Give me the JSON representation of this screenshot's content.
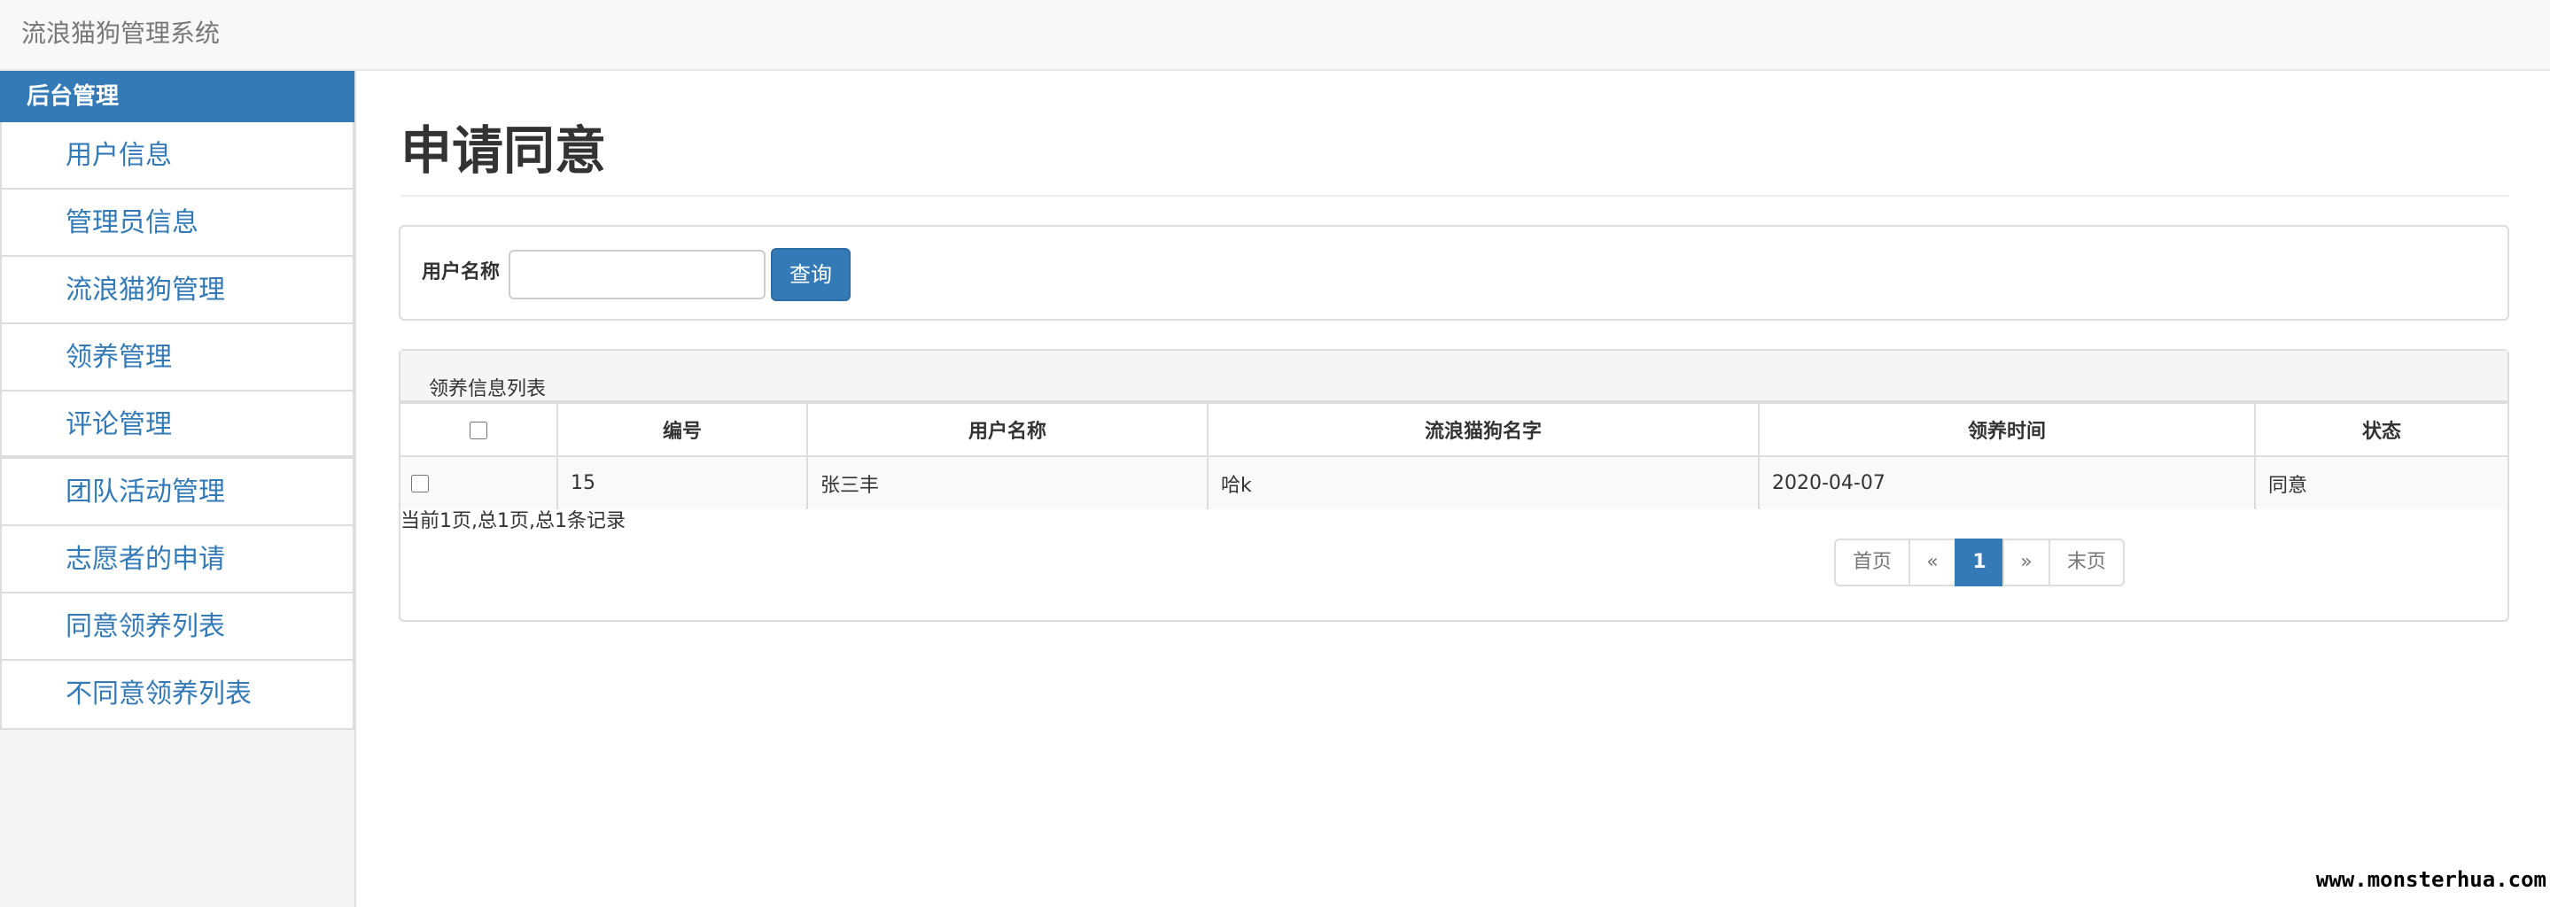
{
  "app": {
    "title": "流浪猫狗管理系统"
  },
  "sidebar": {
    "heading": "后台管理",
    "items": [
      {
        "label": "用户信息"
      },
      {
        "label": "管理员信息"
      },
      {
        "label": "流浪猫狗管理"
      },
      {
        "label": "领养管理"
      },
      {
        "label": "评论管理"
      },
      {
        "label": "团队活动管理"
      },
      {
        "label": "志愿者的申请"
      },
      {
        "label": "同意领养列表"
      },
      {
        "label": "不同意领养列表"
      }
    ]
  },
  "page": {
    "title": "申请同意"
  },
  "search": {
    "label": "用户名称",
    "value": "",
    "button_label": "查询"
  },
  "list": {
    "heading": "领养信息列表",
    "columns": [
      "编号",
      "用户名称",
      "流浪猫狗名字",
      "领养时间",
      "状态"
    ],
    "rows": [
      {
        "id": "15",
        "user_name": "张三丰",
        "pet_name": "哈k",
        "adopt_time": "2020-04-07",
        "status": "同意"
      }
    ]
  },
  "pagination": {
    "info": "当前1页,总1页,总1条记录",
    "first_label": "首页",
    "prev_label": "«",
    "current": "1",
    "next_label": "»",
    "last_label": "末页"
  },
  "watermark": {
    "text": "www.monsterhua.com"
  },
  "colors": {
    "primary": "#337ab7",
    "border": "#dddddd",
    "navbar_bg": "#f8f8f8"
  }
}
